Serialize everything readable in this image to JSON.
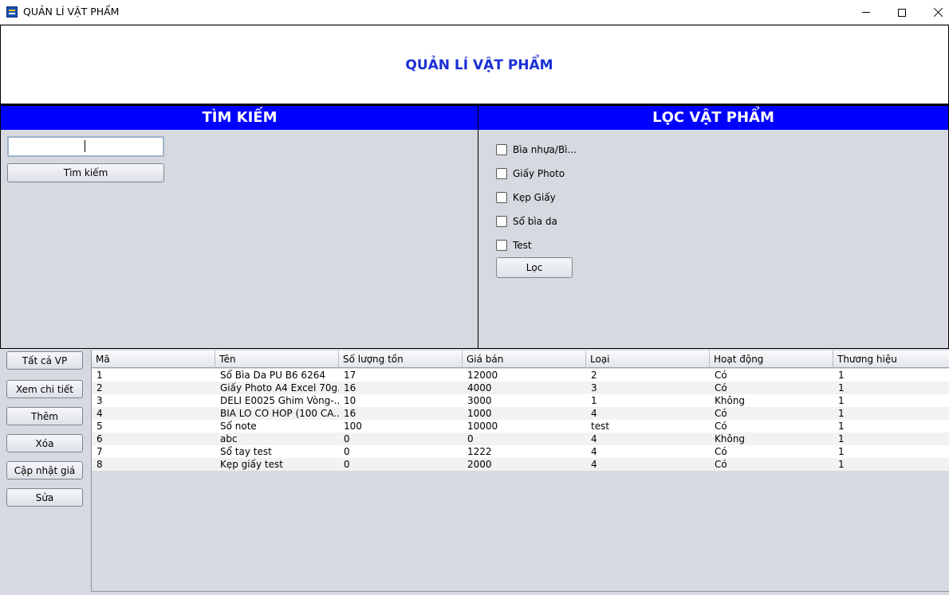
{
  "window": {
    "title": "QUẢN LÍ VẬT PHẨM"
  },
  "header": {
    "title": "QUẢN LÍ VẬT PHẨM",
    "title_color": "#1a2fd6"
  },
  "search_panel": {
    "title": "TÌM KIẾM",
    "input_value": "",
    "button_label": "Tìm kiếm"
  },
  "filter_panel": {
    "title": "LỌC VẬT PHẨM",
    "options": [
      "Bìa nhựa/Bì...",
      "Giấy Photo",
      "Kẹp Giấy",
      "Sổ bìa da",
      "Test"
    ],
    "button_label": "Lọc"
  },
  "actions": {
    "all": "Tất cả VP",
    "details": "Xem chi tiết",
    "add": "Thêm",
    "delete": "Xóa",
    "update_price": "Cập nhật giá",
    "edit": "Sửa"
  },
  "table": {
    "columns": [
      "Mã",
      "Tên",
      "Số lượng tồn",
      "Giá bán",
      "Loại",
      "Hoạt động",
      "Thương hiệu"
    ],
    "rows": [
      [
        "1",
        "Sổ Bìa Da PU B6 6264",
        "17",
        "12000",
        "2",
        "Có",
        "1"
      ],
      [
        "2",
        "Giấy Photo A4 Excel 70g...",
        "16",
        "4000",
        "3",
        "Có",
        "1"
      ],
      [
        "3",
        "DELI E0025 Ghim Vòng-...",
        "10",
        "3000",
        "1",
        "Không",
        "1"
      ],
      [
        "4",
        "BIA LO CO HOP (100 CA...",
        "16",
        "1000",
        "4",
        "Có",
        "1"
      ],
      [
        "5",
        "Sổ note",
        "100",
        "10000",
        "test",
        "Có",
        "1"
      ],
      [
        "6",
        "abc",
        "0",
        "0",
        "4",
        "Không",
        "1"
      ],
      [
        "7",
        "Sổ tay test",
        "0",
        "1222",
        "4",
        "Có",
        "1"
      ],
      [
        "8",
        "Kẹp giấy test",
        "0",
        "2000",
        "4",
        "Có",
        "1"
      ]
    ]
  },
  "colors": {
    "panel_header": "#0000ff",
    "background": "#d6d9df"
  }
}
